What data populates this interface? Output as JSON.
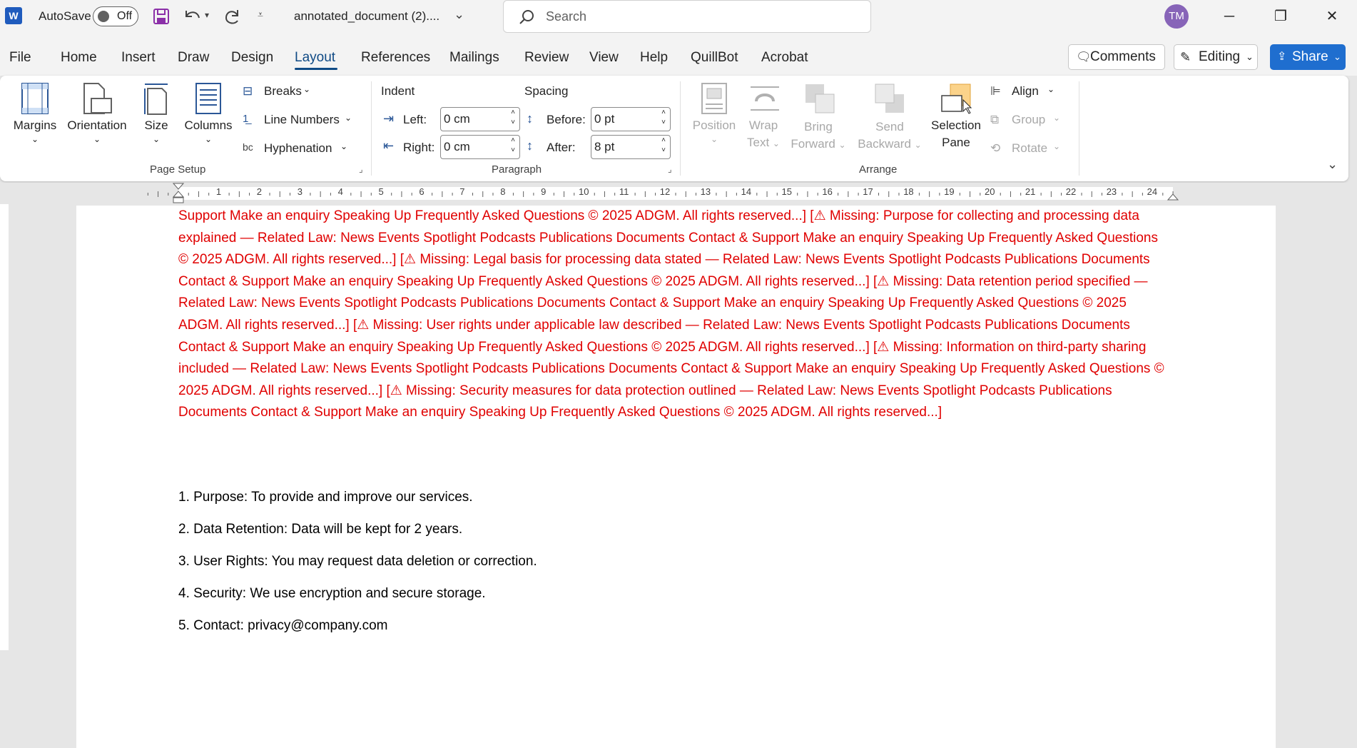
{
  "titlebar": {
    "app_logo": "W",
    "autosave_label": "AutoSave",
    "autosave_state": "Off",
    "doc_title": "annotated_document (2)....",
    "search_placeholder": "Search",
    "avatar_initials": "TM"
  },
  "menu": {
    "items": [
      "File",
      "Home",
      "Insert",
      "Draw",
      "Design",
      "Layout",
      "References",
      "Mailings",
      "Review",
      "View",
      "Help",
      "QuillBot",
      "Acrobat"
    ],
    "active": "Layout",
    "comments_label": "Comments",
    "editing_label": "Editing",
    "share_label": "Share"
  },
  "ribbon": {
    "page_setup": {
      "margins": "Margins",
      "orientation": "Orientation",
      "size": "Size",
      "columns": "Columns",
      "breaks": "Breaks",
      "line_numbers": "Line Numbers",
      "hyphenation": "Hyphenation",
      "group_label": "Page Setup"
    },
    "paragraph": {
      "indent_label": "Indent",
      "spacing_label": "Spacing",
      "left_label": "Left:",
      "right_label": "Right:",
      "before_label": "Before:",
      "after_label": "After:",
      "left_value": "0 cm",
      "right_value": "0 cm",
      "before_value": "0 pt",
      "after_value": "8 pt",
      "group_label": "Paragraph"
    },
    "arrange": {
      "position": "Position",
      "wrap_text_1": "Wrap",
      "wrap_text_2": "Text",
      "bring_forward_1": "Bring",
      "bring_forward_2": "Forward",
      "send_backward_1": "Send",
      "send_backward_2": "Backward",
      "selection_pane_1": "Selection",
      "selection_pane_2": "Pane",
      "align": "Align",
      "group": "Group",
      "rotate": "Rotate",
      "group_label": "Arrange"
    }
  },
  "ruler": {
    "numbers": [
      "1",
      "2",
      "3",
      "4",
      "5",
      "6",
      "7",
      "8",
      "9",
      "10",
      "11",
      "12",
      "13",
      "14",
      "15",
      "16",
      "17",
      "18",
      "19",
      "20",
      "21",
      "22",
      "23",
      "24"
    ]
  },
  "document": {
    "annotation_text": "Support Make an enquiry Speaking Up Frequently Asked Questions © 2025 ADGM. All rights reserved...] [⚠ Missing: Purpose for collecting and processing data explained — Related Law: News Events Spotlight Podcasts Publications Documents Contact & Support Make an enquiry Speaking Up Frequently Asked Questions © 2025 ADGM. All rights reserved...] [⚠ Missing: Legal basis for processing data stated — Related Law: News Events Spotlight Podcasts Publications Documents Contact & Support Make an enquiry Speaking Up Frequently Asked Questions © 2025 ADGM. All rights reserved...] [⚠ Missing: Data retention period specified — Related Law: News Events Spotlight Podcasts Publications Documents Contact & Support Make an enquiry Speaking Up Frequently Asked Questions © 2025 ADGM. All rights reserved...] [⚠ Missing: User rights under applicable law described — Related Law: News Events Spotlight Podcasts Publications Documents Contact & Support Make an enquiry Speaking Up Frequently Asked Questions © 2025 ADGM. All rights reserved...] [⚠ Missing: Information on third-party sharing included — Related Law: News Events Spotlight Podcasts Publications Documents Contact & Support Make an enquiry Speaking Up Frequently Asked Questions © 2025 ADGM. All rights reserved...] [⚠ Missing: Security measures for data protection outlined — Related Law: News Events Spotlight Podcasts Publications Documents Contact & Support Make an enquiry Speaking Up Frequently Asked Questions © 2025 ADGM. All rights reserved...]",
    "list": [
      "1. Purpose: To provide and improve our services.",
      "2. Data Retention: Data will be kept for 2 years.",
      "3. User Rights: You may request data deletion or correction.",
      "4. Security: We use encryption and secure storage.",
      "5. Contact: privacy@company.com"
    ]
  },
  "colors": {
    "accent": "#0f4a85",
    "share_bg": "#1f6ecf",
    "annotation_red": "#e00000",
    "avatar_bg": "#8764b8"
  }
}
